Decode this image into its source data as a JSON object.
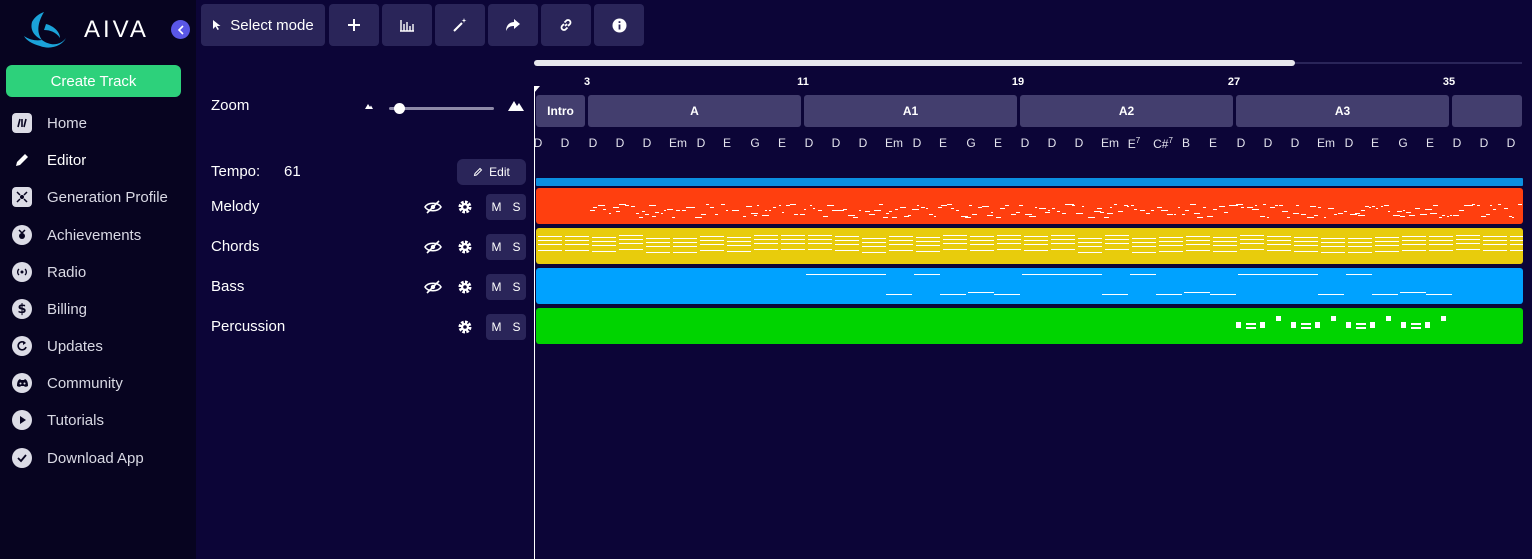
{
  "app": {
    "logo_text": "AIVA",
    "create_track_label": "Create Track"
  },
  "sidebar": {
    "items": [
      {
        "label": "Home",
        "icon": "home-icon",
        "active": false
      },
      {
        "label": "Editor",
        "icon": "pencil-icon",
        "active": true
      },
      {
        "label": "Generation Profile",
        "icon": "generation-profile-icon",
        "active": false
      },
      {
        "label": "Achievements",
        "icon": "medal-icon",
        "active": false
      },
      {
        "label": "Radio",
        "icon": "radio-icon",
        "active": false
      },
      {
        "label": "Billing",
        "icon": "dollar-icon",
        "active": false
      },
      {
        "label": "Updates",
        "icon": "refresh-icon",
        "active": false
      },
      {
        "label": "Community",
        "icon": "discord-icon",
        "active": false
      },
      {
        "label": "Tutorials",
        "icon": "play-icon",
        "active": false
      },
      {
        "label": "Download App",
        "icon": "download-icon",
        "active": false
      }
    ]
  },
  "toolbar": {
    "select_mode_label": "Select mode",
    "buttons": [
      "add-icon",
      "equalizer-icon",
      "magic-wand-icon",
      "share-icon",
      "link-icon",
      "info-icon"
    ]
  },
  "panel": {
    "zoom_label": "Zoom",
    "zoom_level": 0.05,
    "tempo_label": "Tempo:",
    "tempo_value": "61",
    "edit_label": "Edit"
  },
  "tracks": [
    {
      "name": "Melody",
      "color": "#ff3f0f",
      "visibility_toggle": true,
      "mute": "M",
      "solo": "S"
    },
    {
      "name": "Chords",
      "color": "#e8cc0c",
      "visibility_toggle": true,
      "mute": "M",
      "solo": "S"
    },
    {
      "name": "Bass",
      "color": "#00a2ff",
      "visibility_toggle": true,
      "mute": "M",
      "solo": "S"
    },
    {
      "name": "Percussion",
      "color": "#00d400",
      "visibility_toggle": false,
      "mute": "M",
      "solo": "S"
    }
  ],
  "timeline": {
    "bar_numbers": [
      "3",
      "11",
      "19",
      "27",
      "35"
    ],
    "sections": [
      "Intro",
      "A",
      "A1",
      "A2",
      "A3"
    ],
    "chords": [
      {
        "root": "D",
        "ext": ""
      },
      {
        "root": "D",
        "ext": ""
      },
      {
        "root": "D",
        "ext": ""
      },
      {
        "root": "D",
        "ext": ""
      },
      {
        "root": "D",
        "ext": ""
      },
      {
        "root": "Em",
        "ext": ""
      },
      {
        "root": "D",
        "ext": ""
      },
      {
        "root": "E",
        "ext": ""
      },
      {
        "root": "G",
        "ext": ""
      },
      {
        "root": "E",
        "ext": ""
      },
      {
        "root": "D",
        "ext": ""
      },
      {
        "root": "D",
        "ext": ""
      },
      {
        "root": "D",
        "ext": ""
      },
      {
        "root": "Em",
        "ext": ""
      },
      {
        "root": "D",
        "ext": ""
      },
      {
        "root": "E",
        "ext": ""
      },
      {
        "root": "G",
        "ext": ""
      },
      {
        "root": "E",
        "ext": ""
      },
      {
        "root": "D",
        "ext": ""
      },
      {
        "root": "D",
        "ext": ""
      },
      {
        "root": "D",
        "ext": ""
      },
      {
        "root": "Em",
        "ext": ""
      },
      {
        "root": "E",
        "ext": "7"
      },
      {
        "root": "C#",
        "ext": "7"
      },
      {
        "root": "B",
        "ext": ""
      },
      {
        "root": "E",
        "ext": ""
      },
      {
        "root": "D",
        "ext": ""
      },
      {
        "root": "D",
        "ext": ""
      },
      {
        "root": "D",
        "ext": ""
      },
      {
        "root": "Em",
        "ext": ""
      },
      {
        "root": "D",
        "ext": ""
      },
      {
        "root": "E",
        "ext": ""
      },
      {
        "root": "G",
        "ext": ""
      },
      {
        "root": "E",
        "ext": ""
      },
      {
        "root": "D",
        "ext": ""
      },
      {
        "root": "D",
        "ext": ""
      },
      {
        "root": "D",
        "ext": ""
      }
    ],
    "scroll_fraction": 0.77,
    "tempo_bar_color": "#0b8fe0"
  }
}
